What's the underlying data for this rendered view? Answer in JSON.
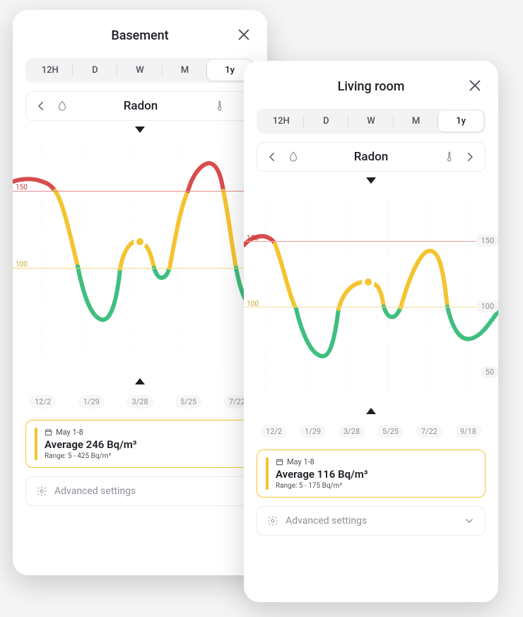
{
  "cards": [
    {
      "title": "Basement",
      "periods": [
        "12H",
        "D",
        "W",
        "M",
        "1y"
      ],
      "periodActive": 4,
      "metric": "Radon",
      "showLeftArrow": true,
      "showRightArrow": false,
      "summary": {
        "date": "May 1-8",
        "avg": "Average 246 Bq/m³",
        "range": "Range: 5 - 425 Bq/m³"
      },
      "adv": "Advanced settings",
      "dates": [
        "12/2",
        "1/29",
        "3/28",
        "5/25",
        "7/22"
      ],
      "yLeft": {
        "150": 150,
        "100": 100
      }
    },
    {
      "title": "Living room",
      "periods": [
        "12H",
        "D",
        "W",
        "M",
        "1y"
      ],
      "periodActive": 4,
      "metric": "Radon",
      "showLeftArrow": true,
      "showRightArrow": true,
      "summary": {
        "date": "May 1-8",
        "avg": "Average 116 Bq/m³",
        "range": "Range: 5 - 175 Bq/m³"
      },
      "adv": "Advanced settings",
      "dates": [
        "12/2",
        "1/29",
        "3/28",
        "5/25",
        "7/22",
        "9/18"
      ],
      "yRight": {
        "150": 150,
        "100": 100,
        "50": 50
      }
    }
  ],
  "chart_data": [
    {
      "type": "line",
      "title": "Basement — Radon (1y)",
      "xlabel": "",
      "ylabel": "Bq/m³",
      "x": [
        "12/2",
        "1/29",
        "3/28",
        "5/25",
        "7/22"
      ],
      "thresholds": {
        "warn": 100,
        "danger": 150
      },
      "ylim": [
        0,
        250
      ],
      "series": [
        {
          "name": "Radon",
          "values_approx": [
            170,
            150,
            60,
            55,
            50,
            100,
            110,
            95,
            95,
            135,
            132,
            100,
            210,
            195,
            115,
            100,
            75,
            70,
            65
          ]
        }
      ],
      "marker": {
        "x_index": 7,
        "y": 110
      },
      "note": "values approximated from pixel inspection; colors change green<100, yellow 100-150, red>150"
    },
    {
      "type": "line",
      "title": "Living room — Radon (1y)",
      "xlabel": "",
      "ylabel": "Bq/m³",
      "x": [
        "12/2",
        "1/29",
        "3/28",
        "5/25",
        "7/22",
        "9/18"
      ],
      "thresholds": {
        "warn": 100,
        "danger": 150
      },
      "ylim": [
        0,
        200
      ],
      "series": [
        {
          "name": "Radon",
          "values_approx": [
            155,
            150,
            100,
            60,
            55,
            50,
            100,
            115,
            112,
            95,
            100,
            140,
            138,
            100,
            80,
            95
          ]
        }
      ],
      "marker": {
        "x_index": 8,
        "y": 113
      },
      "note": "values approximated from pixel inspection"
    }
  ]
}
